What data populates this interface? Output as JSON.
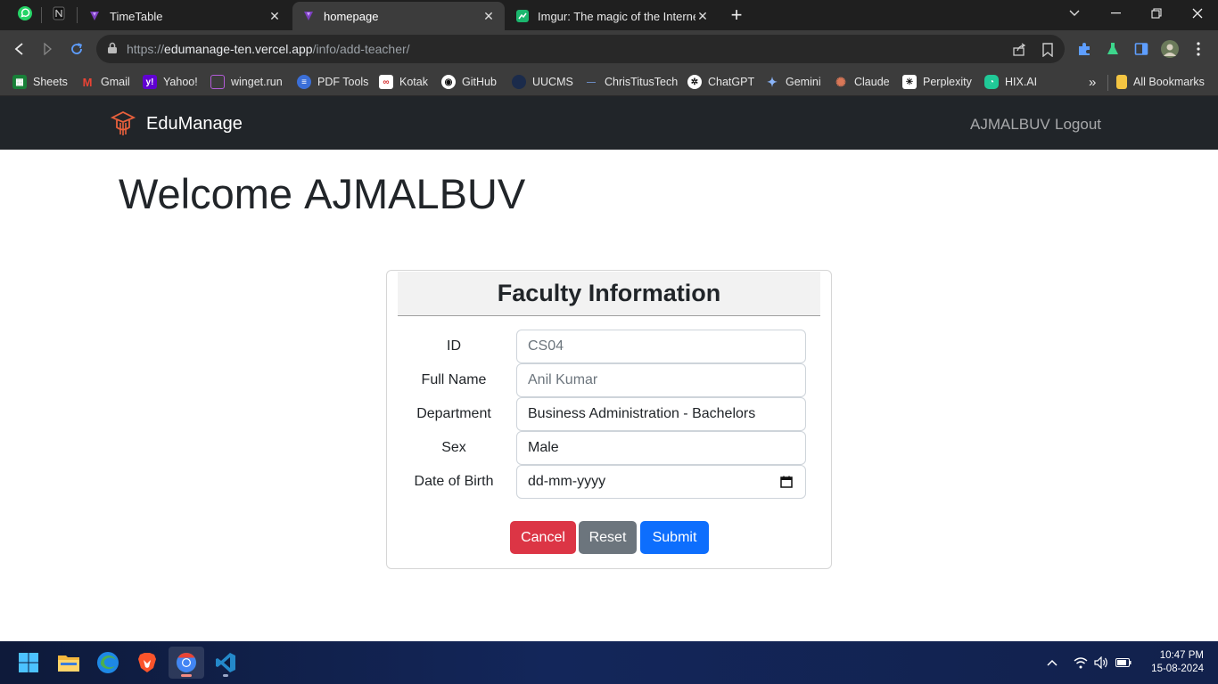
{
  "browser": {
    "tabs": [
      {
        "title": "TimeTable"
      },
      {
        "title": "homepage"
      },
      {
        "title": "Imgur: The magic of the Internet"
      }
    ],
    "url_prefix": "https://",
    "url_domain": "edumanage-ten.vercel.app",
    "url_path": "/info/add-teacher/",
    "bookmarks": [
      {
        "label": "Sheets",
        "icon": "sheets-icon",
        "color": "#188038"
      },
      {
        "label": "Gmail",
        "icon": "gmail-icon",
        "color": "#ea4335"
      },
      {
        "label": "Yahoo!",
        "icon": "yahoo-icon",
        "color": "#6001d2"
      },
      {
        "label": "winget.run",
        "icon": "winget-icon",
        "color": "#8e44ad"
      },
      {
        "label": "PDF Tools",
        "icon": "pdf-tools-icon",
        "color": "#3b6fd8"
      },
      {
        "label": "Kotak",
        "icon": "kotak-icon",
        "color": "#d22b2b"
      },
      {
        "label": "GitHub",
        "icon": "github-icon",
        "color": "#ffffff"
      },
      {
        "label": "UUCMS",
        "icon": "uucms-icon",
        "color": "#1b2b4b"
      },
      {
        "label": "ChrisTitusTech",
        "icon": "christitustech-icon",
        "color": "#3a5a8a"
      },
      {
        "label": "ChatGPT",
        "icon": "chatgpt-icon",
        "color": "#ffffff"
      },
      {
        "label": "Gemini",
        "icon": "gemini-icon",
        "color": "#8ab4f8"
      },
      {
        "label": "Claude",
        "icon": "claude-icon",
        "color": "#d97757"
      },
      {
        "label": "Perplexity",
        "icon": "perplexity-icon",
        "color": "#ffffff"
      },
      {
        "label": "HIX.AI",
        "icon": "hixai-icon",
        "color": "#20c997"
      }
    ],
    "all_bookmarks_label": "All Bookmarks",
    "more_bookmarks_glyph": "»"
  },
  "app": {
    "brand": "EduManage",
    "nav_user": "AJMALBUV",
    "nav_logout": "Logout",
    "welcome_prefix": "Welcome",
    "welcome_user": "AJMALBUV"
  },
  "form": {
    "title": "Faculty Information",
    "fields": [
      {
        "label": "ID",
        "value": "",
        "placeholder": "CS04"
      },
      {
        "label": "Full Name",
        "value": "",
        "placeholder": "Anil Kumar"
      },
      {
        "label": "Department",
        "value": "Business Administration - Bachelors",
        "placeholder": ""
      },
      {
        "label": "Sex",
        "value": "Male",
        "placeholder": ""
      },
      {
        "label": "Date of Birth",
        "value": "dd-mm-yyyy",
        "placeholder": ""
      }
    ],
    "buttons": {
      "cancel": "Cancel",
      "reset": "Reset",
      "submit": "Submit"
    },
    "colors": {
      "cancel": "#dc3545",
      "reset": "#6c757d",
      "submit": "#0d6efd"
    }
  },
  "taskbar": {
    "time": "10:47 PM",
    "date": "15-08-2024"
  }
}
